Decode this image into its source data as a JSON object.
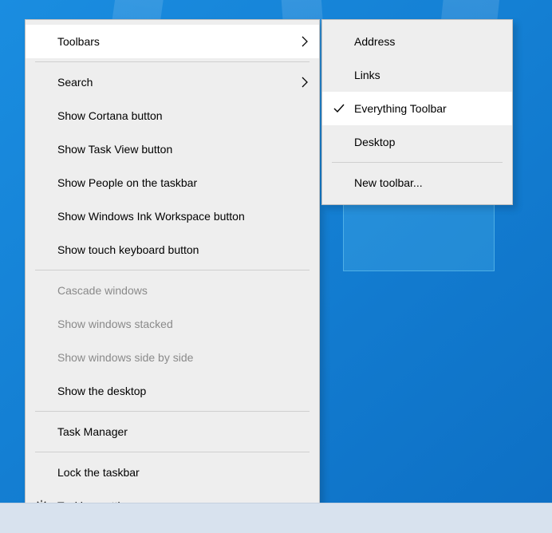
{
  "main_menu": {
    "toolbars": "Toolbars",
    "search": "Search",
    "show_cortana": "Show Cortana button",
    "show_task_view": "Show Task View button",
    "show_people": "Show People on the taskbar",
    "show_ink": "Show Windows Ink Workspace button",
    "show_touch_kb": "Show touch keyboard button",
    "cascade": "Cascade windows",
    "stacked": "Show windows stacked",
    "side_by_side": "Show windows side by side",
    "show_desktop": "Show the desktop",
    "task_manager": "Task Manager",
    "lock_taskbar": "Lock the taskbar",
    "taskbar_settings": "Taskbar settings"
  },
  "sub_menu": {
    "address": "Address",
    "links": "Links",
    "everything": "Everything Toolbar",
    "desktop": "Desktop",
    "new_toolbar": "New toolbar..."
  }
}
